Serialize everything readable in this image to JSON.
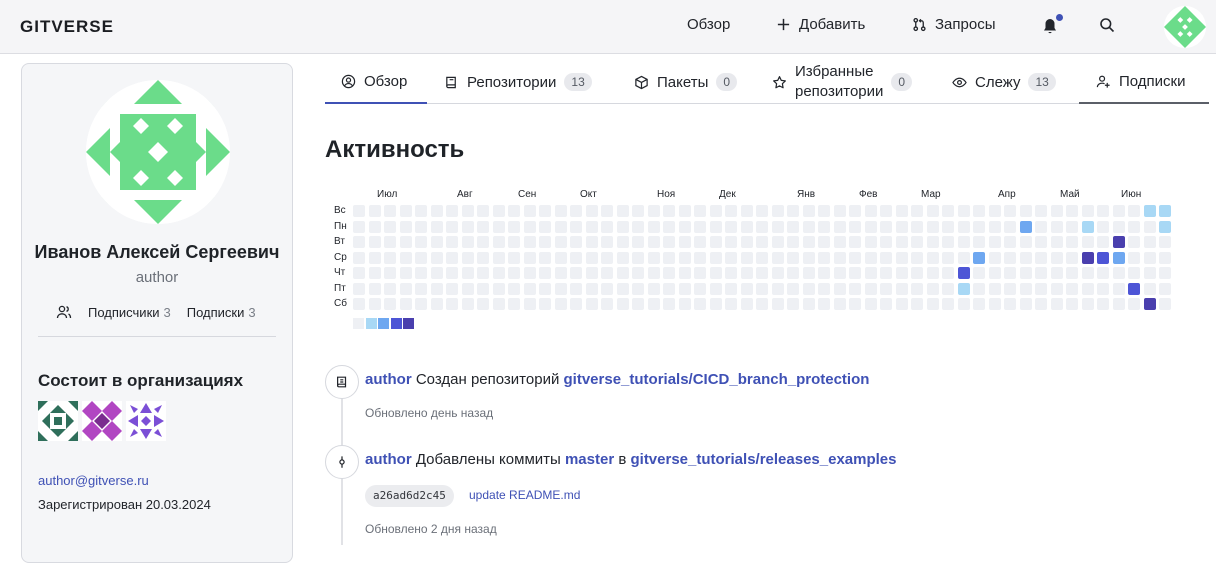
{
  "brand": "GITVERSE",
  "colors": {
    "accent": "#3f51b5",
    "avatar_green": "#6bdc8a",
    "heat_levels": [
      "#eef0f4",
      "#a8d8f5",
      "#6ea7f0",
      "#4d55d6",
      "#4a3fae"
    ],
    "bell_dot": "#3f51b5"
  },
  "topnav": {
    "overview": "Обзор",
    "add": "Добавить",
    "requests": "Запросы",
    "icons": [
      "plus-icon",
      "pull-request-icon",
      "bell-icon",
      "search-icon"
    ]
  },
  "profile": {
    "full_name": "Иванов Алексей Сергеевич",
    "login": "author",
    "followers_label": "Подписчики",
    "followers_count": "3",
    "following_label": "Подписки",
    "following_count": "3",
    "orgs_title": "Состоит в организациях",
    "email": "author@gitverse.ru",
    "registered": "Зарегистрирован 20.03.2024"
  },
  "tabs": [
    {
      "label": "Обзор",
      "icon": "user-circle-icon",
      "count": ""
    },
    {
      "label": "Репозитории",
      "icon": "book-icon",
      "count": "13"
    },
    {
      "label": "Пакеты",
      "icon": "package-icon",
      "count": "0"
    },
    {
      "label": "Избранные",
      "label2": "репозитории",
      "icon": "star-icon",
      "count": "0"
    },
    {
      "label": "Слежу",
      "icon": "eye-icon",
      "count": "13"
    },
    {
      "label": "Подписки",
      "icon": "user-plus-icon",
      "count": ""
    }
  ],
  "activity": {
    "title": "Активность",
    "months": [
      "Июл",
      "Авг",
      "Сен",
      "Окт",
      "Ноя",
      "Дек",
      "Янв",
      "Фев",
      "Мар",
      "Апр",
      "Май",
      "Июн"
    ],
    "days": [
      "Вс",
      "Пн",
      "Вт",
      "Ср",
      "Чт",
      "Пт",
      "Сб"
    ],
    "weeks": 53,
    "active_cells": [
      {
        "week": 39,
        "day": 4,
        "level": 3
      },
      {
        "week": 39,
        "day": 5,
        "level": 1
      },
      {
        "week": 40,
        "day": 3,
        "level": 2
      },
      {
        "week": 43,
        "day": 1,
        "level": 2
      },
      {
        "week": 47,
        "day": 1,
        "level": 1
      },
      {
        "week": 47,
        "day": 3,
        "level": 4
      },
      {
        "week": 48,
        "day": 3,
        "level": 3
      },
      {
        "week": 49,
        "day": 2,
        "level": 4
      },
      {
        "week": 49,
        "day": 3,
        "level": 2
      },
      {
        "week": 50,
        "day": 5,
        "level": 3
      },
      {
        "week": 51,
        "day": 0,
        "level": 1
      },
      {
        "week": 51,
        "day": 6,
        "level": 4
      },
      {
        "week": 52,
        "day": 0,
        "level": 1
      },
      {
        "week": 52,
        "day": 1,
        "level": 1
      }
    ]
  },
  "feed": [
    {
      "icon": "repo-icon",
      "actor": "author",
      "action": "Создан репозиторий",
      "target": "gitverse_tutorials/CICD_branch_protection",
      "updated": "Обновлено день назад"
    },
    {
      "icon": "commit-icon",
      "actor": "author",
      "action": "Добавлены коммиты",
      "branch": "master",
      "preposition": "в",
      "target": "gitverse_tutorials/releases_examples",
      "sha": "a26ad6d2c45",
      "commit_message": "update README.md",
      "updated": "Обновлено 2 дня назад"
    }
  ]
}
